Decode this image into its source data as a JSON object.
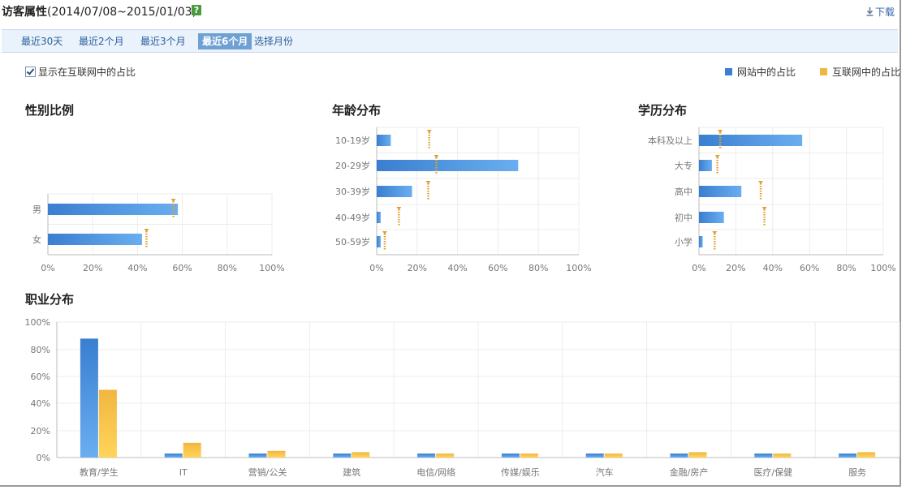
{
  "header": {
    "title_strong": "访客属性",
    "title_range": "(2014/07/08~2015/01/03)",
    "help_label": "?",
    "download_label": "下载"
  },
  "tabs": [
    {
      "label": "最近30天",
      "active": false
    },
    {
      "label": "最近2个月",
      "active": false
    },
    {
      "label": "最近3个月",
      "active": false
    },
    {
      "label": "最近6个月",
      "active": true
    },
    {
      "label": "选择月份",
      "active": false
    }
  ],
  "controls": {
    "show_internet_label": "显示在互联网中的占比",
    "show_internet_checked": true
  },
  "colors": {
    "site": "#3a7fd0",
    "site_light": "#6aaef0",
    "internet": "#f2b640",
    "internet_light": "#ffd45a"
  },
  "legend": {
    "site_label": "网站中的占比",
    "internet_label": "互联网中的占比"
  },
  "chart_data": [
    {
      "id": "gender",
      "type": "bar",
      "orientation": "horizontal",
      "title": "性别比例",
      "categories": [
        "男",
        "女"
      ],
      "series": [
        {
          "name": "网站中的占比",
          "values": [
            58,
            42
          ]
        },
        {
          "name": "互联网中的占比",
          "values": [
            56,
            44
          ]
        }
      ],
      "xticks": [
        "0%",
        "20%",
        "40%",
        "60%",
        "80%",
        "100%"
      ],
      "xlim": [
        0,
        100
      ]
    },
    {
      "id": "age",
      "type": "bar",
      "orientation": "horizontal",
      "title": "年龄分布",
      "categories": [
        "10-19岁",
        "20-29岁",
        "30-39岁",
        "40-49岁",
        "50-59岁"
      ],
      "series": [
        {
          "name": "网站中的占比",
          "values": [
            7,
            70,
            17.5,
            2,
            2
          ]
        },
        {
          "name": "互联网中的占比",
          "values": [
            26,
            29.5,
            25.5,
            11,
            4
          ]
        }
      ],
      "xticks": [
        "0%",
        "20%",
        "40%",
        "60%",
        "80%",
        "100%"
      ],
      "xlim": [
        0,
        100
      ]
    },
    {
      "id": "education",
      "type": "bar",
      "orientation": "horizontal",
      "title": "学历分布",
      "categories": [
        "本科及以上",
        "大专",
        "高中",
        "初中",
        "小学"
      ],
      "series": [
        {
          "name": "网站中的占比",
          "values": [
            56,
            7,
            23,
            13.5,
            2
          ]
        },
        {
          "name": "互联网中的占比",
          "values": [
            11.5,
            10,
            33.5,
            35.5,
            8.5
          ]
        }
      ],
      "xticks": [
        "0%",
        "20%",
        "40%",
        "60%",
        "80%",
        "100%"
      ],
      "xlim": [
        0,
        100
      ]
    },
    {
      "id": "occupation",
      "type": "bar",
      "orientation": "vertical",
      "title": "职业分布",
      "categories": [
        "教育/学生",
        "IT",
        "营销/公关",
        "建筑",
        "电信/网络",
        "传媒/娱乐",
        "汽车",
        "金融/房产",
        "医疗/保健",
        "服务"
      ],
      "series": [
        {
          "name": "网站中的占比",
          "values": [
            88,
            3,
            3,
            3,
            3,
            3,
            3,
            3,
            3,
            3
          ]
        },
        {
          "name": "互联网中的占比",
          "values": [
            50,
            11,
            5,
            4,
            3,
            3,
            3,
            4,
            3,
            4
          ]
        }
      ],
      "yticks": [
        "0%",
        "20%",
        "40%",
        "60%",
        "80%",
        "100%"
      ],
      "ylim": [
        0,
        100
      ]
    }
  ]
}
